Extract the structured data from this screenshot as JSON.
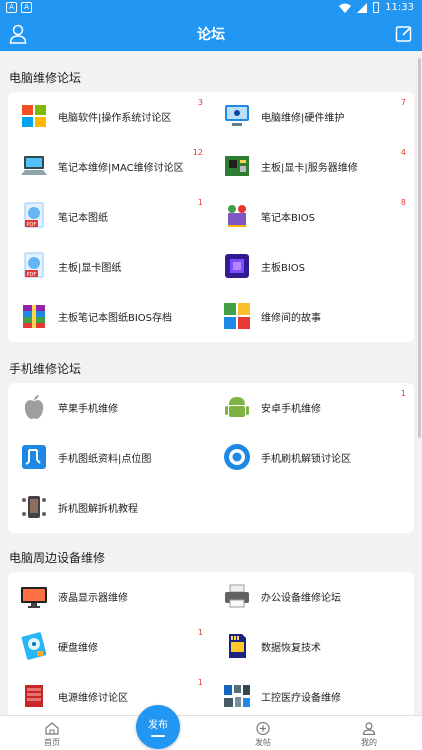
{
  "status_bar": {
    "time": "11:33"
  },
  "header": {
    "title": "论坛",
    "user_icon": "user-icon",
    "edit_icon": "edit-icon"
  },
  "sections": [
    {
      "title": "电脑维修论坛",
      "items": [
        {
          "label": "电脑软件|操作系统讨论区",
          "count": "3",
          "icon": "windows-icon"
        },
        {
          "label": "电脑维修|硬件维护",
          "count": "7",
          "icon": "computer-repair-icon"
        },
        {
          "label": "笔记本维修|MAC维修讨论区",
          "count": "12",
          "icon": "laptop-icon"
        },
        {
          "label": "主板|显卡|服务器维修",
          "count": "4",
          "icon": "motherboard-icon"
        },
        {
          "label": "笔记本图纸",
          "count": "1",
          "icon": "pdf-icon"
        },
        {
          "label": "笔记本BIOS",
          "count": "8",
          "icon": "bios-chip-icon"
        },
        {
          "label": "主板|显卡图纸",
          "count": "",
          "icon": "pdf-icon"
        },
        {
          "label": "主板BIOS",
          "count": "",
          "icon": "chip-icon"
        },
        {
          "label": "主板笔记本图纸BIOS存档",
          "count": "",
          "icon": "archive-icon"
        },
        {
          "label": "维修间的故事",
          "count": "",
          "icon": "stories-icon"
        }
      ]
    },
    {
      "title": "手机维修论坛",
      "items": [
        {
          "label": "苹果手机维修",
          "count": "",
          "icon": "apple-icon"
        },
        {
          "label": "安卓手机维修",
          "count": "1",
          "icon": "android-icon"
        },
        {
          "label": "手机图纸资料|点位图",
          "count": "",
          "icon": "schematic-icon"
        },
        {
          "label": "手机刷机解锁讨论区",
          "count": "",
          "icon": "unlock-icon"
        },
        {
          "label": "拆机图解拆机教程",
          "count": "",
          "icon": "teardown-icon"
        }
      ]
    },
    {
      "title": "电脑周边设备维修",
      "items": [
        {
          "label": "液晶显示器维修",
          "count": "",
          "icon": "monitor-icon"
        },
        {
          "label": "办公设备维修论坛",
          "count": "",
          "icon": "printer-icon"
        },
        {
          "label": "硬盘维修",
          "count": "1",
          "icon": "hard-drive-icon"
        },
        {
          "label": "数据恢复技术",
          "count": "",
          "icon": "sd-card-icon"
        },
        {
          "label": "电源维修讨论区",
          "count": "1",
          "icon": "power-supply-icon"
        },
        {
          "label": "工控医疗设备维修",
          "count": "",
          "icon": "industrial-icon"
        }
      ]
    }
  ],
  "bottom_nav": {
    "home": "首页",
    "publish": "发布",
    "post": "发帖",
    "me": "我的"
  },
  "colors": {
    "primary": "#2196f3",
    "badge": "#e53935"
  }
}
